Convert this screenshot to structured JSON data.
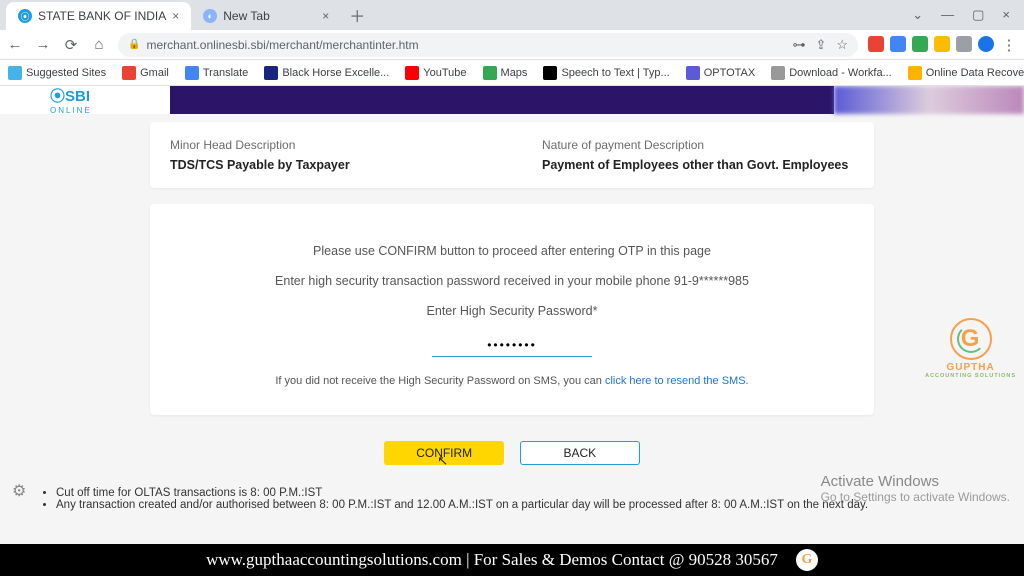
{
  "browser": {
    "tabs": [
      {
        "title": "STATE BANK OF INDIA",
        "favcolor": "#1f9ed9"
      },
      {
        "title": "New Tab",
        "favcolor": "#8ab4f8"
      }
    ],
    "url": "merchant.onlinesbi.sbi/merchant/merchantinter.htm",
    "bookmarks": [
      {
        "label": "Suggested Sites",
        "color": "#44b3e6"
      },
      {
        "label": "Gmail",
        "color": "#ea4335"
      },
      {
        "label": "Translate",
        "color": "#4285f4"
      },
      {
        "label": "Black Horse Excelle...",
        "color": "#1a237e"
      },
      {
        "label": "YouTube",
        "color": "#ff0000"
      },
      {
        "label": "Maps",
        "color": "#34a853"
      },
      {
        "label": "Speech to Text | Typ...",
        "color": "#000"
      },
      {
        "label": "OPTOTAX",
        "color": "#5b5bd6"
      },
      {
        "label": "Download - Workfa...",
        "color": "#999"
      },
      {
        "label": "Online Data Recove...",
        "color": "#ffb300"
      }
    ]
  },
  "logo": {
    "main": "⦿SBI",
    "sub": "ONLINE"
  },
  "summary": {
    "minor_label": "Minor Head Description",
    "minor_value": "TDS/TCS Payable by Taxpayer",
    "nature_label": "Nature of payment Description",
    "nature_value": "Payment of Employees other than Govt. Employees"
  },
  "otp": {
    "line1": "Please use CONFIRM button to proceed after entering OTP in this page",
    "line2": "Enter high security transaction password received in your mobile phone 91-9******985",
    "line3": "Enter High Security Password*",
    "value": "••••••••",
    "resend_prefix": "If you did not receive the High Security Password on SMS, you can ",
    "resend_link": "click here to resend the SMS."
  },
  "buttons": {
    "confirm": "CONFIRM",
    "back": "BACK"
  },
  "notes": {
    "n1": "Cut off time for OLTAS transactions is 8: 00 P.M.:IST",
    "n2": "Any transaction created and/or authorised between 8: 00 P.M.:IST and 12.00 A.M.:IST on a particular day will be processed after 8: 00 A.M.:IST on the next day."
  },
  "activate": {
    "t1": "Activate Windows",
    "t2": "Go to Settings to activate Windows."
  },
  "watermark": {
    "brand": "GUPTHA",
    "sub": "ACCOUNTING SOLUTIONS"
  },
  "footer": {
    "text": "www.gupthaaccountingsolutions.com | For Sales & Demos Contact @ 90528 30567"
  }
}
